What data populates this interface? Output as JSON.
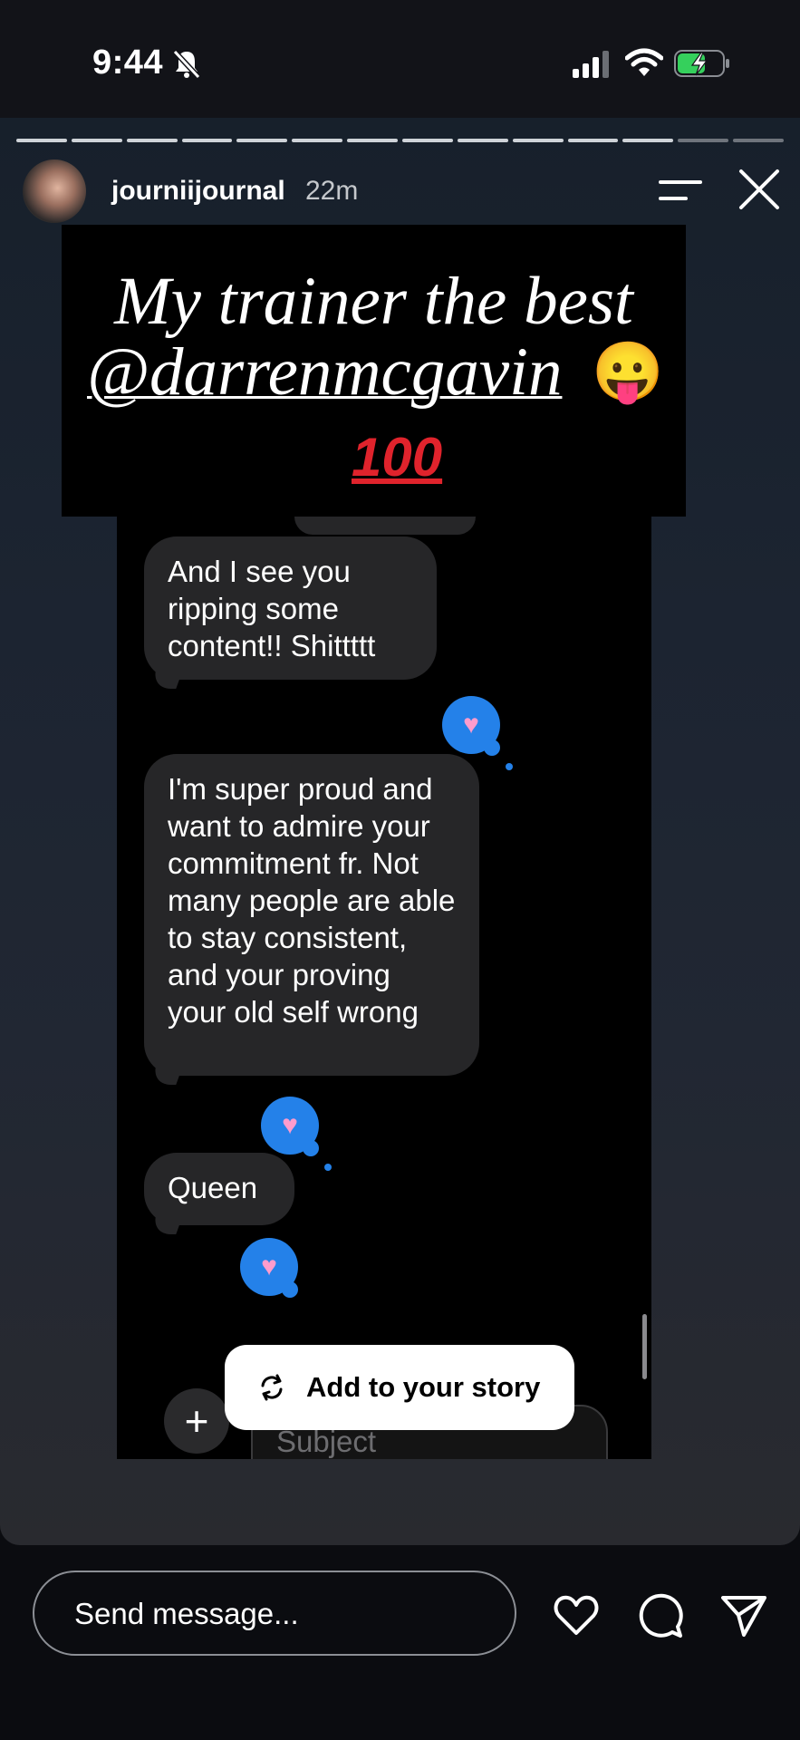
{
  "status_bar": {
    "time": "9:44"
  },
  "story": {
    "progress_total": 14,
    "progress_current": 12,
    "username": "journiijournal",
    "time_ago": "22m"
  },
  "caption": {
    "line1": "My trainer the best",
    "mention": "@darrenmcgavin",
    "emoji_face": "😛",
    "emoji_100": "100"
  },
  "chat": {
    "messages": [
      "And I see you ripping some content!! Shittttt",
      "I'm super proud and want to admire your commitment fr. Not many people are able to stay consistent, and your proving your old self wrong",
      "Queen"
    ],
    "reaction_icon": "heart",
    "subject_placeholder": "Subject",
    "plus_label": "+"
  },
  "add_story": {
    "label": "Add to your story"
  },
  "composer": {
    "placeholder": "Send message...",
    "icons": [
      "heart-icon",
      "comment-icon",
      "share-icon"
    ]
  },
  "colors": {
    "accent_blue": "#2481e9",
    "bubble_gray": "#262628",
    "reaction_heart": "#ff9ccd",
    "red_100": "#e0232c"
  }
}
